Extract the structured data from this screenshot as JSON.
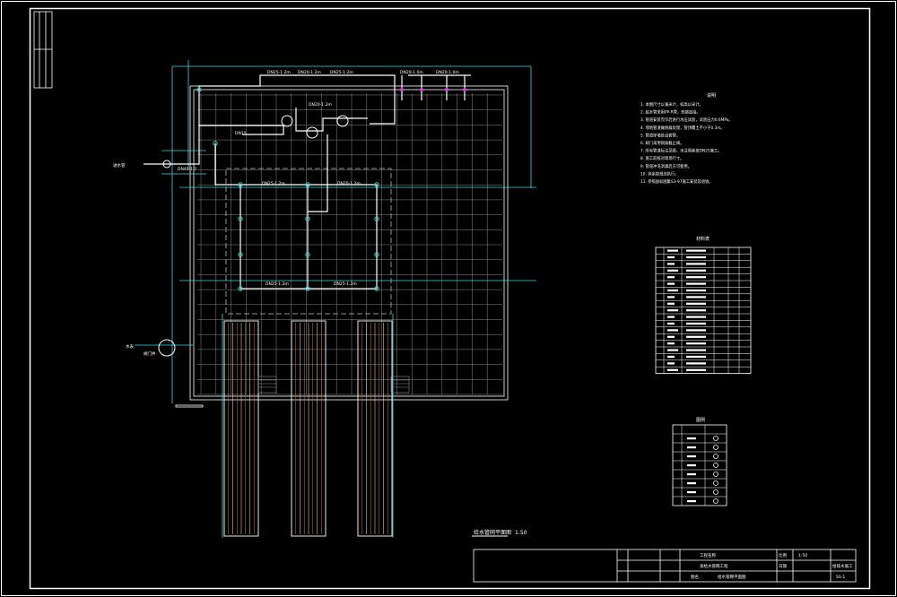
{
  "drawing": {
    "background": "#000000",
    "line_white": "#ffffff",
    "line_cyan": "#3ad8d8",
    "line_grey": "#8a8a8a",
    "line_magenta": "#e040e0",
    "line_brown": "#b86a30",
    "title": "给水管网平面图",
    "scale": "1:50",
    "notes_title": "说明",
    "notes": [
      "1. 本图尺寸以毫米计，标高以米计。",
      "2. 给水管采用PP-R管，热熔连接。",
      "3. 管道安装完毕后进行水压试验，试验压力0.6MPa。",
      "4. 埋地管道做防腐处理，管顶覆土不小于0.3m。",
      "5. 管道穿墙处设套管。",
      "6. 阀门采用铜质截止阀。",
      "7. 所有管道标注见图，未注明者按DN25施工。",
      "8. 施工前核对现场尺寸。",
      "9. 管道冲洗消毒后方可使用。",
      "10. 其余按规范执行。",
      "11. 参照国标图集S3-97施工安装及验收。"
    ],
    "table1_title": "材料表",
    "table2_title": "图例",
    "title_block": {
      "project": "工程名称",
      "project_name": "某给水管网工程",
      "drawing_name": "给水管网平面图",
      "drawing_label": "图名",
      "scale_label": "比例",
      "scale_value": "1:50",
      "date_label": "日期",
      "sheet_no": "SS-1",
      "drawing_no": "给排水施工"
    },
    "pipe_labels": [
      "DN25-1.2m",
      "DN20-1.2m",
      "DN25-1.2m",
      "DN20-1.0m",
      "DN20-1.0m",
      "DN15",
      "DN25-1.2m",
      "DN20-1.2m",
      "DN25-1.2m",
      "DN25-1.2m",
      "DN20-1.2m"
    ],
    "inlet_label": "进水管",
    "inlet_label2": "DN40-1.2",
    "meter_label": "水表",
    "meter_label2": "阀门井"
  }
}
